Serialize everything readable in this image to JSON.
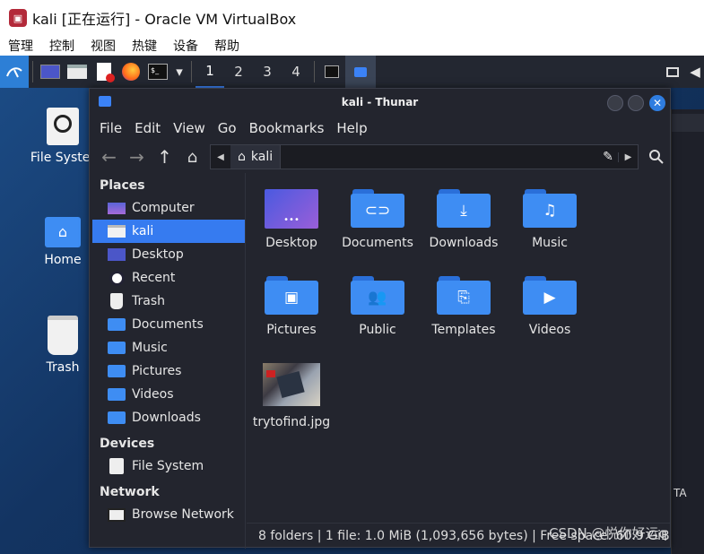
{
  "window": {
    "title": "kali [正在运行] - Oracle VM VirtualBox"
  },
  "vbox_menu": [
    "管理",
    "控制",
    "视图",
    "热键",
    "设备",
    "帮助"
  ],
  "panel": {
    "workspaces": [
      "1",
      "2",
      "3",
      "4"
    ]
  },
  "desktop_icons": [
    {
      "label": "File Syster",
      "icon": "drive-icon"
    },
    {
      "label": "Home",
      "icon": "home-folder-icon"
    },
    {
      "label": "Trash",
      "icon": "trash-icon"
    }
  ],
  "thunar": {
    "title": "kali - Thunar",
    "menu": [
      "File",
      "Edit",
      "View",
      "Go",
      "Bookmarks",
      "Help"
    ],
    "path": "kali",
    "sidebar": {
      "places_header": "Places",
      "places": [
        {
          "label": "Computer",
          "icon": "computer-icon"
        },
        {
          "label": "kali",
          "icon": "home-icon",
          "selected": true
        },
        {
          "label": "Desktop",
          "icon": "desktop-icon"
        },
        {
          "label": "Recent",
          "icon": "recent-icon"
        },
        {
          "label": "Trash",
          "icon": "trash-icon"
        },
        {
          "label": "Documents",
          "icon": "documents-icon"
        },
        {
          "label": "Music",
          "icon": "music-icon"
        },
        {
          "label": "Pictures",
          "icon": "pictures-icon"
        },
        {
          "label": "Videos",
          "icon": "videos-icon"
        },
        {
          "label": "Downloads",
          "icon": "downloads-icon"
        }
      ],
      "devices_header": "Devices",
      "devices": [
        {
          "label": "File System",
          "icon": "drive-icon"
        }
      ],
      "network_header": "Network",
      "network": [
        {
          "label": "Browse Network",
          "icon": "network-icon"
        }
      ]
    },
    "files": [
      {
        "label": "Desktop",
        "glyph": "•••"
      },
      {
        "label": "Documents",
        "glyph": "⊂⊃"
      },
      {
        "label": "Downloads",
        "glyph": "⤓"
      },
      {
        "label": "Music",
        "glyph": "♫"
      },
      {
        "label": "Pictures",
        "glyph": "▣"
      },
      {
        "label": "Public",
        "glyph": "👥"
      },
      {
        "label": "Templates",
        "glyph": "⎘"
      },
      {
        "label": "Videos",
        "glyph": "▶"
      },
      {
        "label": "trytofind.jpg",
        "glyph": ""
      }
    ],
    "status": "8 folders  |  1 file: 1.0 MiB (1,093,656 bytes)  |  Free space: 60.9 GiB"
  },
  "background_window_text": "TA",
  "watermark": "CSDN @悦你好运q"
}
